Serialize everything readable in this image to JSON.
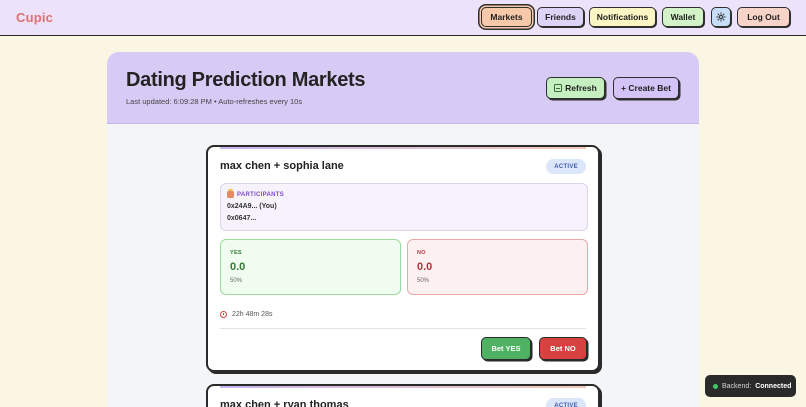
{
  "app": {
    "logo": "Cupic"
  },
  "nav": {
    "markets": "Markets",
    "friends": "Friends",
    "notifications": "Notifications",
    "wallet": "Wallet",
    "settings_icon": "gear-icon",
    "logout": "Log Out"
  },
  "header": {
    "title": "Dating Prediction Markets",
    "subtitle": "Last updated: 6:09:28 PM • Auto-refreshes every 10s",
    "refresh": "Refresh",
    "create": "+ Create Bet"
  },
  "markets": [
    {
      "title": "max chen + sophia lane",
      "status": "ACTIVE",
      "participants_label": "PARTICIPANTS",
      "participants": [
        "0x24A9... (You)",
        "0x0647..."
      ],
      "yes": {
        "label": "YES",
        "value": "0.0",
        "pct": "50%"
      },
      "no": {
        "label": "NO",
        "value": "0.0",
        "pct": "50%"
      },
      "time_left": "22h 48m 28s",
      "bet_yes": "Bet YES",
      "bet_no": "Bet NO"
    },
    {
      "title": "max chen + ryan thomas",
      "status": "ACTIVE"
    }
  ],
  "status_bar": {
    "label": "Backend:",
    "value": "Connected"
  },
  "colors": {
    "accent_logo": "#e0706e",
    "header_bg": "#d7cbf6",
    "yes_green": "#4fb162",
    "no_red": "#d7413f",
    "status_dot": "#3fc56a"
  }
}
